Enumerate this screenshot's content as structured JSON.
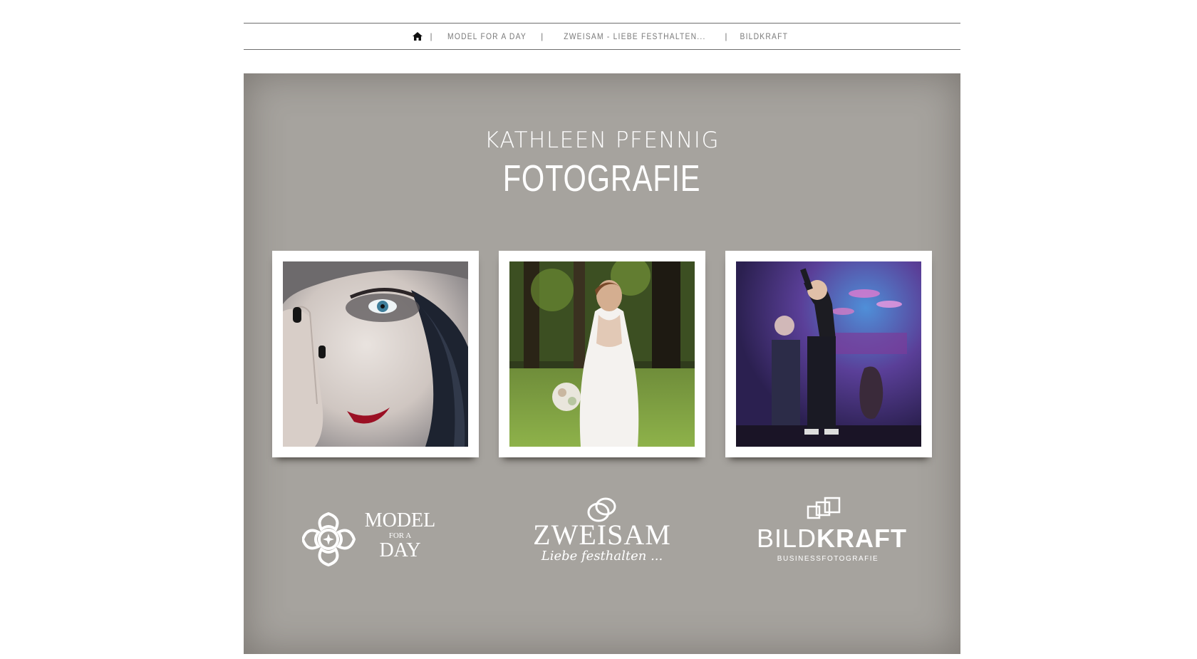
{
  "nav": {
    "home_icon": "home-icon",
    "separator": "|",
    "items": [
      {
        "label": "MODEL FOR A DAY"
      },
      {
        "label": "ZWEISAM - LIEBE FESTHALTEN..."
      },
      {
        "label": "BILDKRAFT"
      }
    ]
  },
  "hero": {
    "name": "KATHLEEN PFENNIG",
    "title": "FOTOGRAFIE",
    "background_color": "#a6a39e"
  },
  "gallery": [
    {
      "subject": "portrait-woman-hand-over-eye"
    },
    {
      "subject": "bride-in-lace-dress-in-forest"
    },
    {
      "subject": "singer-on-stage-concert"
    }
  ],
  "logos": {
    "model_for_a_day": {
      "line1": "MODEL",
      "line2": "FOR A",
      "line3": "DAY"
    },
    "zweisam": {
      "name": "ZWEISAM",
      "tagline": "Liebe festhalten ..."
    },
    "bildkraft": {
      "name_light": "BILD",
      "name_bold": "KRAFT",
      "tagline": "BUSINESSFOTOGRAFIE"
    }
  }
}
